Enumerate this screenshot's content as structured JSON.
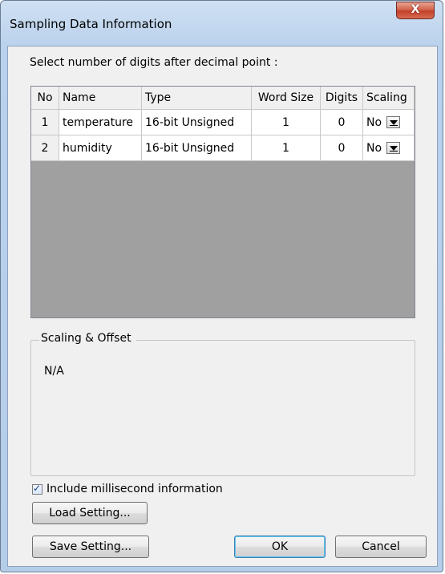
{
  "window": {
    "title": "Sampling Data Information",
    "close_label": "X"
  },
  "prompt": "Select number of digits after decimal point :",
  "table": {
    "columns": [
      "No",
      "Name",
      "Type",
      "Word Size",
      "Digits",
      "Scaling"
    ],
    "rows": [
      {
        "no": "1",
        "name": "temperature",
        "type": "16-bit Unsigned",
        "word_size": "1",
        "digits": "0",
        "scaling": "No"
      },
      {
        "no": "2",
        "name": "humidity",
        "type": "16-bit Unsigned",
        "word_size": "1",
        "digits": "0",
        "scaling": "No"
      }
    ]
  },
  "scaling_group": {
    "label": "Scaling & Offset",
    "value": "N/A"
  },
  "options": {
    "include_ms_label": "Include millisecond information",
    "include_ms_checked": true
  },
  "buttons": {
    "load": "Load Setting...",
    "save": "Save Setting...",
    "ok": "OK",
    "cancel": "Cancel"
  }
}
